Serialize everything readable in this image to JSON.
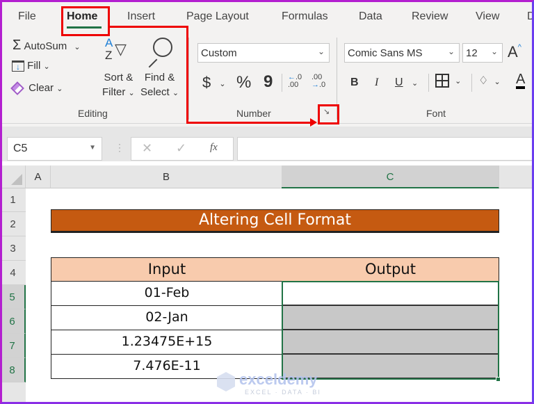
{
  "tabs": [
    {
      "label": "File"
    },
    {
      "label": "Home",
      "active": true
    },
    {
      "label": "Insert"
    },
    {
      "label": "Page Layout"
    },
    {
      "label": "Formulas"
    },
    {
      "label": "Data"
    },
    {
      "label": "Review"
    },
    {
      "label": "View"
    },
    {
      "label": "D"
    }
  ],
  "ribbon": {
    "editing": {
      "autosum": "AutoSum",
      "fill": "Fill",
      "clear": "Clear",
      "sort_line1": "Sort &",
      "sort_line2": "Filter",
      "find_line1": "Find &",
      "find_line2": "Select",
      "group_label": "Editing"
    },
    "number": {
      "format_value": "Custom",
      "currency": "$",
      "percent": "%",
      "comma": "9",
      "group_label": "Number"
    },
    "font": {
      "font_name": "Comic Sans MS",
      "font_size": "12",
      "bold": "B",
      "italic": "I",
      "underline": "U",
      "grow": "A",
      "font_color": "A",
      "group_label": "Font"
    }
  },
  "formula_bar": {
    "name_box": "C5",
    "fx": "fx",
    "formula": ""
  },
  "sheet": {
    "columns": [
      "A",
      "B",
      "C"
    ],
    "rows": [
      "1",
      "2",
      "3",
      "4",
      "5",
      "6",
      "7",
      "8"
    ],
    "selected_cell": "C5",
    "title": "Altering Cell Format",
    "headers": [
      "Input",
      "Output"
    ],
    "inputs": [
      "01-Feb",
      "02-Jan",
      "1.23475E+15",
      "7.476E-11"
    ],
    "outputs": [
      "",
      "",
      "",
      ""
    ]
  },
  "colors": {
    "title_fill": "#c55a11",
    "header_fill": "#f8cbad",
    "selection": "#217346",
    "annotation": "#e00000"
  },
  "watermark": {
    "name": "exceldemy",
    "tagline": "EXCEL · DATA · BI"
  }
}
